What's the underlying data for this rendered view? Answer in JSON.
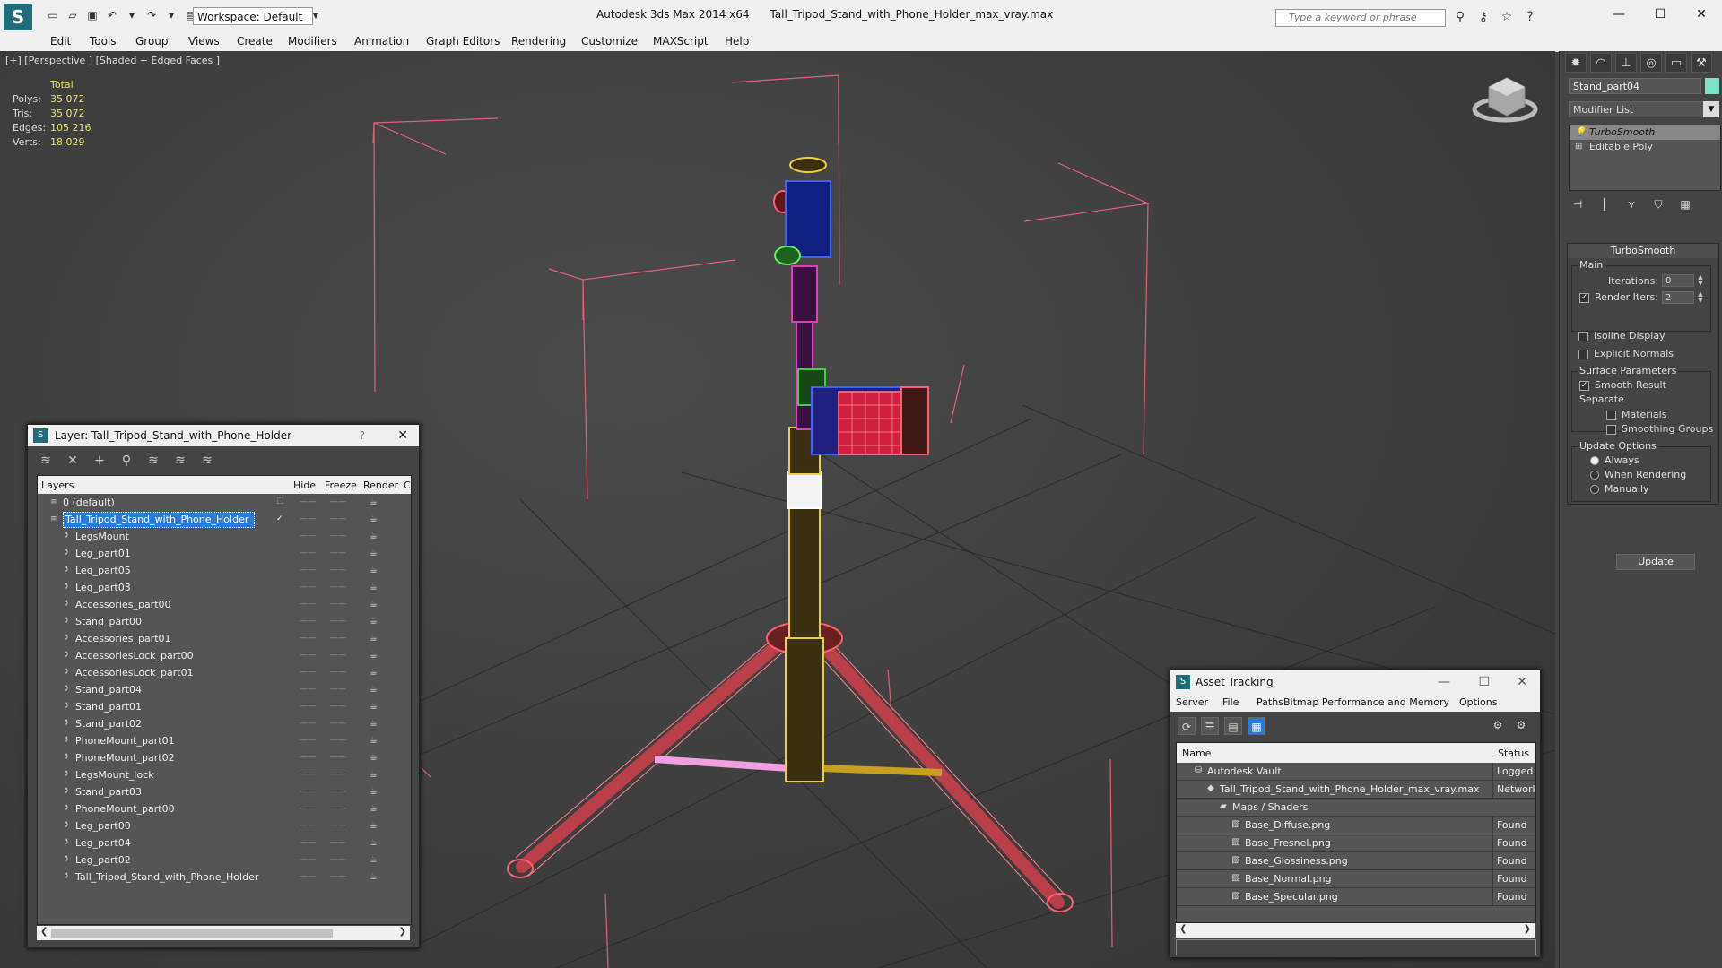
{
  "titlebar": {
    "app_title": "Autodesk 3ds Max  2014 x64",
    "file_name": "Tall_Tripod_Stand_with_Phone_Holder_max_vray.max",
    "workspace": "Workspace: Default",
    "search_placeholder": "Type a keyword or phrase"
  },
  "menu": [
    "Edit",
    "Tools",
    "Group",
    "Views",
    "Create",
    "Modifiers",
    "Animation",
    "Graph Editors",
    "Rendering",
    "Customize",
    "MAXScript",
    "Help"
  ],
  "viewport": {
    "label": "[+] [Perspective ] [Shaded + Edged Faces ]",
    "stats": {
      "header": "Total",
      "polys_label": "Polys:",
      "polys": "35 072",
      "tris_label": "Tris:",
      "tris": "35 072",
      "edges_label": "Edges:",
      "edges": "105 216",
      "verts_label": "Verts:",
      "verts": "18 029"
    }
  },
  "command_panel": {
    "object_name": "Stand_part04",
    "object_color": "#7fe0c8",
    "modifier_list": "Modifier List",
    "stack": [
      "TurboSmooth",
      "Editable Poly"
    ],
    "rollout_title": "TurboSmooth",
    "main": {
      "title": "Main",
      "iterations_label": "Iterations:",
      "iterations": "0",
      "render_iters_label": "Render Iters:",
      "render_iters": "2",
      "isoline": "Isoline Display",
      "explicit": "Explicit Normals"
    },
    "surface": {
      "title": "Surface Parameters",
      "smooth_result": "Smooth Result",
      "separate": "Separate",
      "materials": "Materials",
      "smoothing_groups": "Smoothing Groups"
    },
    "update": {
      "title": "Update Options",
      "always": "Always",
      "when_rendering": "When Rendering",
      "manually": "Manually",
      "button": "Update"
    }
  },
  "layer_dialog": {
    "title": "Layer: Tall_Tripod_Stand_with_Phone_Holder",
    "help": "?",
    "columns": {
      "layers": "Layers",
      "hide": "Hide",
      "freeze": "Freeze",
      "render": "Render",
      "c": "C"
    },
    "layers": [
      {
        "name": "0 (default)",
        "level": 0
      },
      {
        "name": "Tall_Tripod_Stand_with_Phone_Holder",
        "level": 0
      },
      {
        "name": "LegsMount",
        "level": 1
      },
      {
        "name": "Leg_part01",
        "level": 1
      },
      {
        "name": "Leg_part05",
        "level": 1
      },
      {
        "name": "Leg_part03",
        "level": 1
      },
      {
        "name": "Accessories_part00",
        "level": 1
      },
      {
        "name": "Stand_part00",
        "level": 1
      },
      {
        "name": "Accessories_part01",
        "level": 1
      },
      {
        "name": "AccessoriesLock_part00",
        "level": 1
      },
      {
        "name": "AccessoriesLock_part01",
        "level": 1
      },
      {
        "name": "Stand_part04",
        "level": 1
      },
      {
        "name": "Stand_part01",
        "level": 1
      },
      {
        "name": "Stand_part02",
        "level": 1
      },
      {
        "name": "PhoneMount_part01",
        "level": 1
      },
      {
        "name": "PhoneMount_part02",
        "level": 1
      },
      {
        "name": "LegsMount_lock",
        "level": 1
      },
      {
        "name": "Stand_part03",
        "level": 1
      },
      {
        "name": "PhoneMount_part00",
        "level": 1
      },
      {
        "name": "Leg_part00",
        "level": 1
      },
      {
        "name": "Leg_part04",
        "level": 1
      },
      {
        "name": "Leg_part02",
        "level": 1
      },
      {
        "name": "Tall_Tripod_Stand_with_Phone_Holder",
        "level": 1
      }
    ]
  },
  "asset_dialog": {
    "title": "Asset Tracking",
    "menu": [
      "Server",
      "File",
      "Paths",
      "Bitmap Performance and Memory",
      "Options"
    ],
    "columns": {
      "name": "Name",
      "status": "Status"
    },
    "rows": [
      {
        "name": "Autodesk Vault",
        "status": "Logged O",
        "level": 0
      },
      {
        "name": "Tall_Tripod_Stand_with_Phone_Holder_max_vray.max",
        "status": "Network P",
        "level": 1
      },
      {
        "name": "Maps / Shaders",
        "status": "",
        "level": 2
      },
      {
        "name": "Base_Diffuse.png",
        "status": "Found",
        "level": 3
      },
      {
        "name": "Base_Fresnel.png",
        "status": "Found",
        "level": 3
      },
      {
        "name": "Base_Glossiness.png",
        "status": "Found",
        "level": 3
      },
      {
        "name": "Base_Normal.png",
        "status": "Found",
        "level": 3
      },
      {
        "name": "Base_Specular.png",
        "status": "Found",
        "level": 3
      }
    ]
  }
}
